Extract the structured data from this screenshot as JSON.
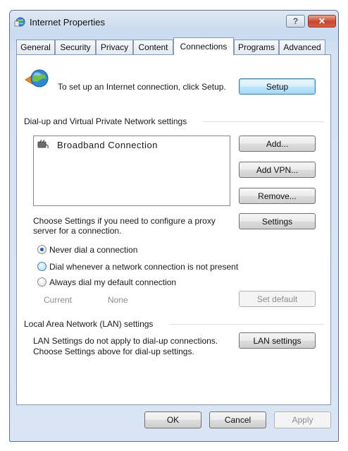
{
  "window": {
    "title": "Internet Properties",
    "help_label": "?",
    "close_label": "✕"
  },
  "tabs": [
    {
      "label": "General"
    },
    {
      "label": "Security"
    },
    {
      "label": "Privacy"
    },
    {
      "label": "Content"
    },
    {
      "label": "Connections"
    },
    {
      "label": "Programs"
    },
    {
      "label": "Advanced"
    }
  ],
  "active_tab": "Connections",
  "setup": {
    "text": "To set up an Internet connection, click Setup.",
    "button": "Setup"
  },
  "dialup": {
    "header": "Dial-up and Virtual Private Network settings",
    "connections": [
      {
        "name": "Broadband Connection"
      }
    ],
    "add": "Add...",
    "add_vpn": "Add VPN...",
    "remove": "Remove...",
    "proxy_text": "Choose Settings if you need to configure a proxy server for a connection.",
    "settings": "Settings"
  },
  "dial_options": [
    {
      "label": "Never dial a connection",
      "selected": true
    },
    {
      "label": "Dial whenever a network connection is not present",
      "selected": false
    },
    {
      "label": "Always dial my default connection",
      "selected": false
    }
  ],
  "default_connection": {
    "current_label": "Current",
    "current_value": "None",
    "set_default": "Set default"
  },
  "lan": {
    "header": "Local Area Network (LAN) settings",
    "text": "LAN Settings do not apply to dial-up connections. Choose Settings above for dial-up settings.",
    "button": "LAN settings"
  },
  "footer": {
    "ok": "OK",
    "cancel": "Cancel",
    "apply": "Apply"
  },
  "colors": {
    "window_frame": "#c9daef",
    "default_button": "#bee6fd",
    "close_button": "#c7462e",
    "radio_selected": "#1a5fb4"
  }
}
